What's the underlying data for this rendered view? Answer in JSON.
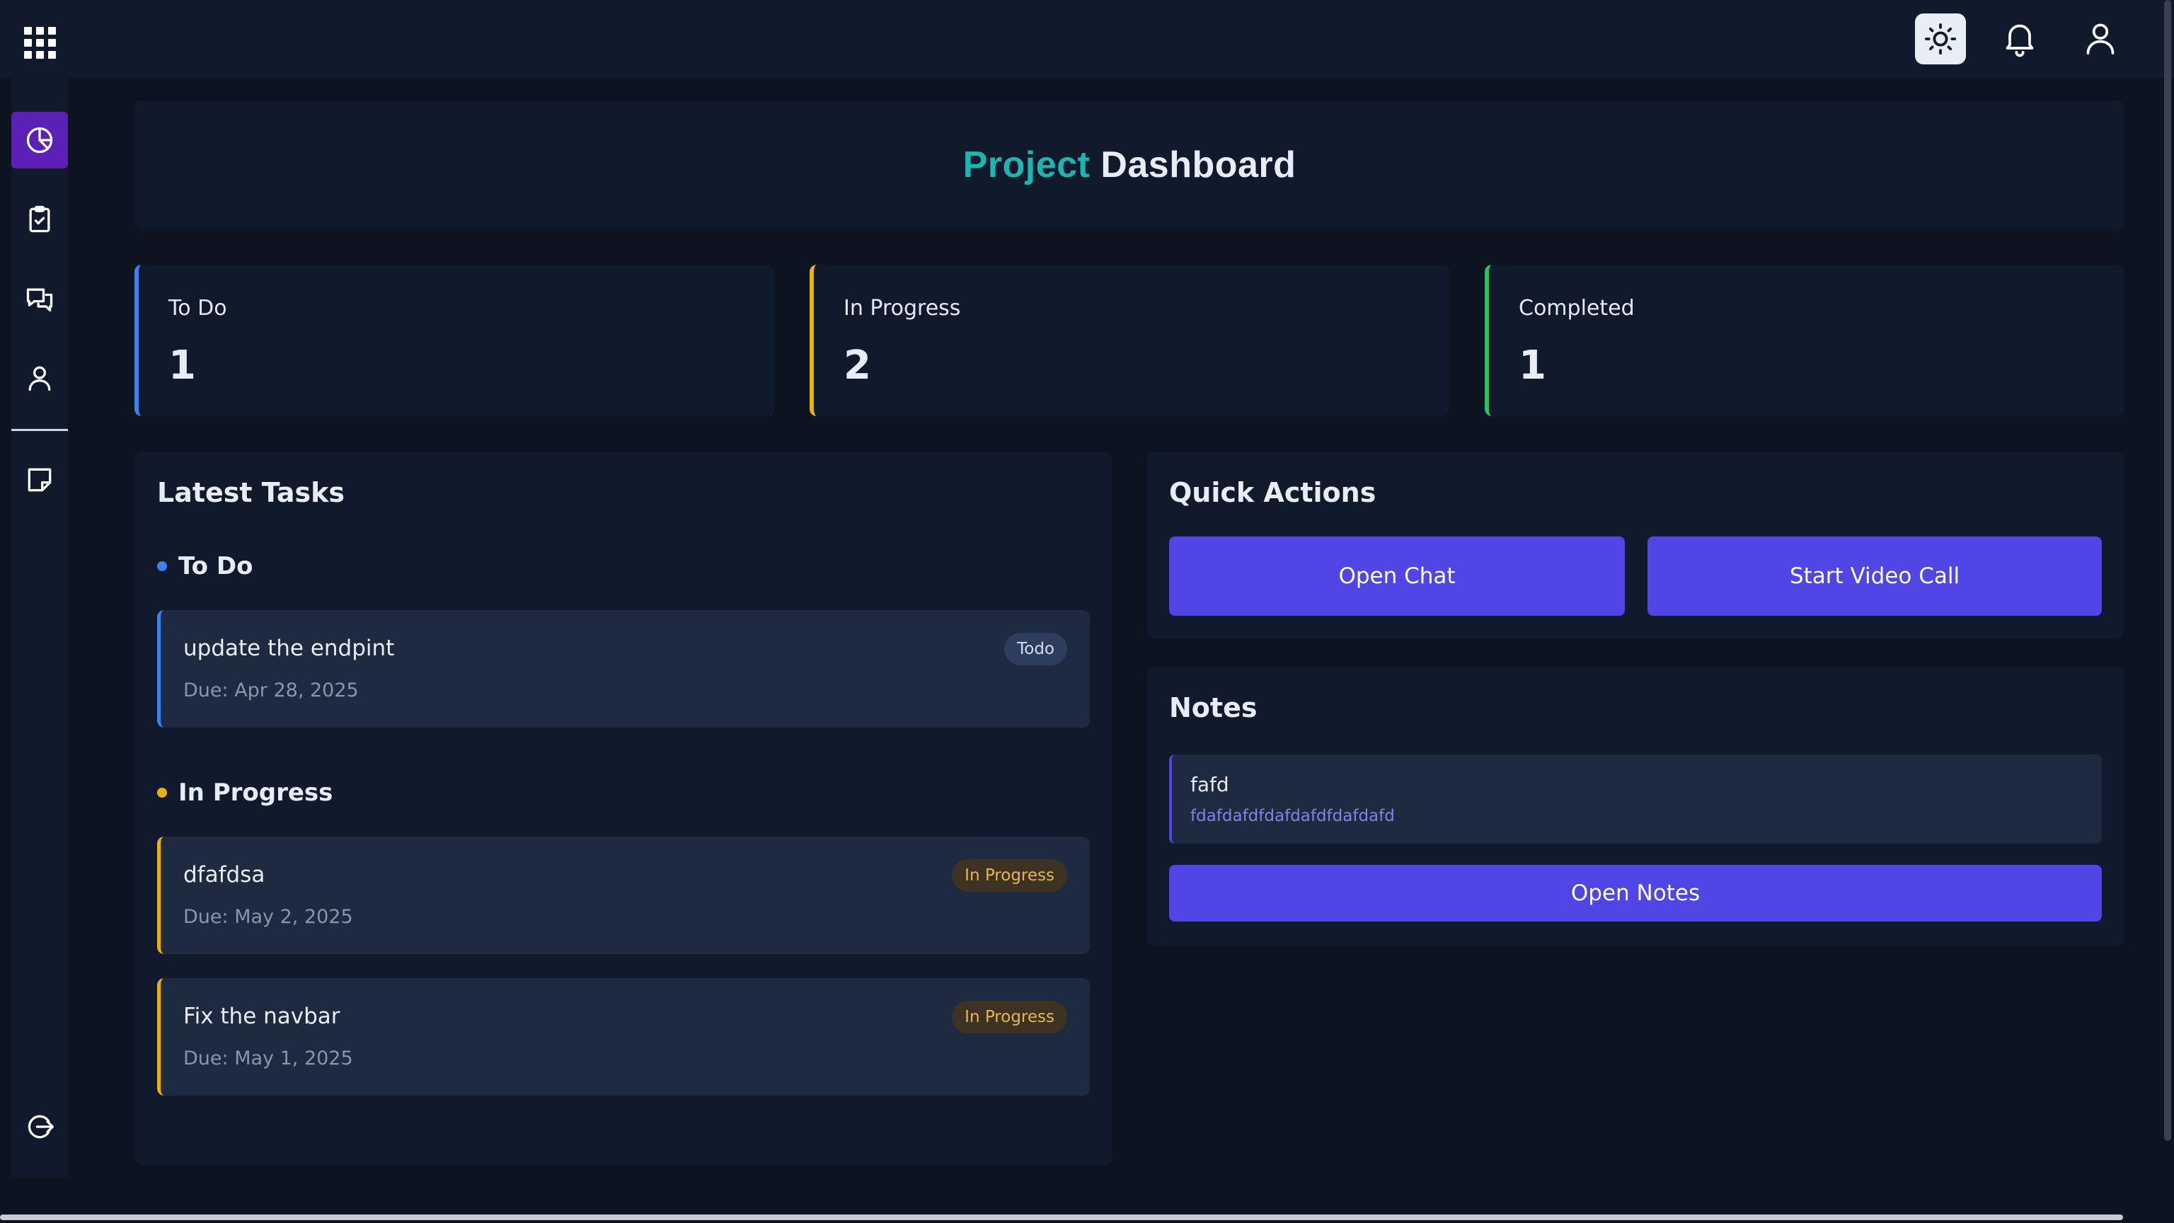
{
  "topbar": {
    "apps_icon": "grid-icon",
    "theme_icon": "sun-icon",
    "notifications_icon": "bell-icon",
    "profile_icon": "user-icon"
  },
  "sidebar": {
    "items": [
      {
        "icon": "pie-chart-icon",
        "active": true
      },
      {
        "icon": "clipboard-check-icon",
        "active": false
      },
      {
        "icon": "chat-icon",
        "active": false
      },
      {
        "icon": "user-icon",
        "active": false
      },
      {
        "icon": "sticky-note-icon",
        "active": false
      }
    ],
    "logout_icon": "logout-icon"
  },
  "header": {
    "title_highlight": "Project",
    "title_rest": "Dashboard"
  },
  "stats": [
    {
      "label": "To Do",
      "count": "1",
      "color": "#3b82f6"
    },
    {
      "label": "In Progress",
      "count": "2",
      "color": "#eab308"
    },
    {
      "label": "Completed",
      "count": "1",
      "color": "#22c55e"
    }
  ],
  "latest_tasks": {
    "title": "Latest Tasks",
    "groups": [
      {
        "title": "To Do",
        "color": "#3b82f6",
        "tasks": [
          {
            "title": "update the endpint",
            "due": "Due: Apr 28, 2025",
            "badge": "Todo"
          }
        ]
      },
      {
        "title": "In Progress",
        "color": "#eab308",
        "tasks": [
          {
            "title": "dfafdsa",
            "due": "Due: May 2, 2025",
            "badge": "In Progress"
          },
          {
            "title": "Fix the navbar",
            "due": "Due: May 1, 2025",
            "badge": "In Progress"
          }
        ]
      }
    ]
  },
  "quick_actions": {
    "title": "Quick Actions",
    "open_chat": "Open Chat",
    "start_video_call": "Start Video Call"
  },
  "notes": {
    "title": "Notes",
    "items": [
      {
        "title": "fafd",
        "body": "fdafdafdfdafdafdfdafdafd"
      }
    ],
    "open_notes": "Open Notes"
  }
}
